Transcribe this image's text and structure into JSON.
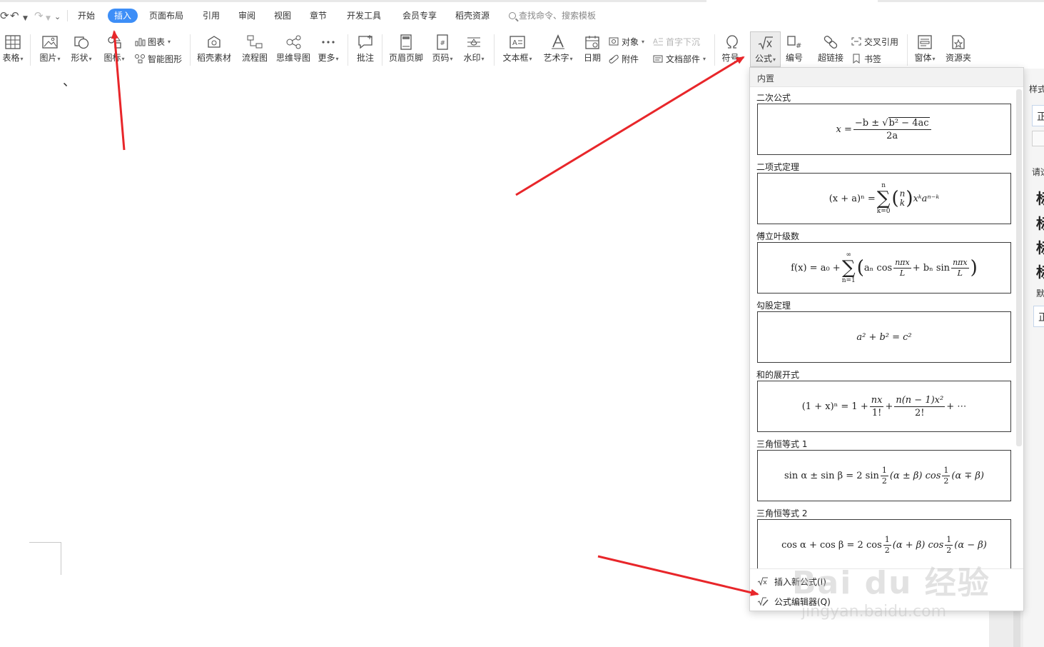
{
  "menu": {
    "tabs": [
      "开始",
      "插入",
      "页面布局",
      "引用",
      "审阅",
      "视图",
      "章节",
      "开发工具",
      "会员专享",
      "稻壳资源"
    ],
    "active_tab": "插入",
    "search_placeholder": "查找命令、搜索模板"
  },
  "ribbon": {
    "table": "表格",
    "picture": "图片",
    "shape": "形状",
    "icon": "图标",
    "chart": "图表",
    "smart_art": "智能图形",
    "docer_material": "稻壳素材",
    "flowchart": "流程图",
    "mindmap": "思维导图",
    "more": "更多",
    "comment": "批注",
    "header_footer": "页眉页脚",
    "page_number": "页码",
    "watermark": "水印",
    "textbox": "文本框",
    "wordart": "艺术字",
    "date": "日期",
    "object": "对象",
    "attachment": "附件",
    "drop_cap": "首字下沉",
    "doc_parts": "文档部件",
    "symbol": "符号",
    "formula": "公式",
    "numbering": "编号",
    "hyperlink": "超链接",
    "cross_ref": "交叉引用",
    "bookmark": "书签",
    "window": "窗体",
    "resource": "资源夹"
  },
  "document": {
    "comma": "、"
  },
  "side_panel": {
    "style_label": "样式",
    "style_value": "正",
    "hint": "请选",
    "headings": [
      "标",
      "标",
      "标",
      "标"
    ],
    "default_label": "默",
    "default_value": "正"
  },
  "formula_dropdown": {
    "header": "内置",
    "items": [
      {
        "title": "二次公式",
        "lhs": "x =",
        "num_pre": "−b ±",
        "num_root": "b² − 4ac",
        "den": "2a"
      },
      {
        "title": "二项式定理",
        "lhs": "(x + a)ⁿ =",
        "sum_upper": "n",
        "sum_lower": "k=0",
        "binom_top": "n",
        "binom_bottom": "k",
        "rhs": "xᵏaⁿ⁻ᵏ"
      },
      {
        "title": "傅立叶级数",
        "lhs": "f(x) = a₀ +",
        "sum_upper": "∞",
        "sum_lower": "n=1",
        "an": "aₙ cos",
        "frac_num": "nπx",
        "frac_den": "L",
        "bn": "+ bₙ sin",
        "frac2_num": "nπx",
        "frac2_den": "L"
      },
      {
        "title": "勾股定理",
        "expr": "a² + b² = c²"
      },
      {
        "title": "和的展开式",
        "lhs": "(1 + x)ⁿ = 1 +",
        "f1_num": "nx",
        "f1_den": "1!",
        "plus": "+",
        "f2_num": "n(n − 1)x²",
        "f2_den": "2!",
        "tail": "+ ⋯"
      },
      {
        "title": "三角恒等式 1",
        "lhs": "sin α ± sin β = 2 sin",
        "half_num": "1",
        "half_den": "2",
        "mid": "(α ± β) cos",
        "half2_num": "1",
        "half2_den": "2",
        "end": "(α ∓ β)"
      },
      {
        "title": "三角恒等式 2",
        "lhs": "cos α + cos β = 2 cos",
        "half_num": "1",
        "half_den": "2",
        "mid": "(α + β) cos",
        "half2_num": "1",
        "half2_den": "2",
        "end": "(α − β)"
      }
    ],
    "insert_new": "插入新公式(I)",
    "editor": "公式编辑器(Q)"
  },
  "watermark": {
    "brand": "Bai du 经验",
    "url": "jingyan.baidu.com"
  },
  "colors": {
    "active_tab_bg": "#3d8ef7",
    "arrow_red": "#e8262a",
    "formula_box_border": "#3c3c3c"
  }
}
